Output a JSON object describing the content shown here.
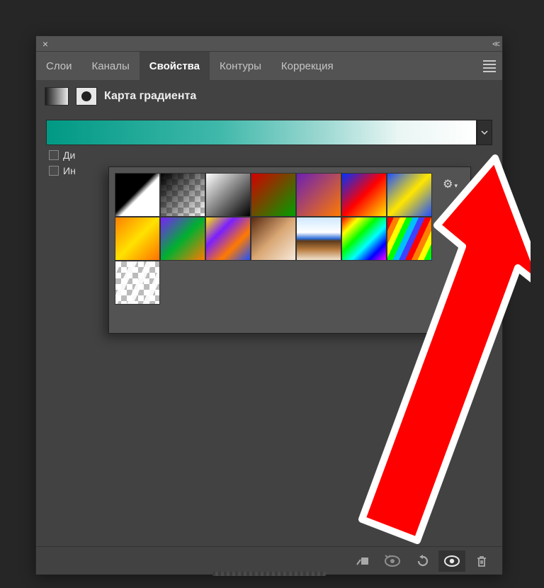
{
  "tabs": {
    "items": [
      "Слои",
      "Каналы",
      "Свойства",
      "Контуры",
      "Коррекция"
    ],
    "activeIndex": 2
  },
  "header": {
    "label": "Карта градиента"
  },
  "checks": {
    "dither": "Ди",
    "invert": "Ин"
  },
  "popup": {
    "gear": "⚙"
  },
  "swatches": [
    {
      "id": "bw",
      "style": "linear-gradient(135deg,#000 0%,#000 45%,#fff 55%,#fff 100%)",
      "cls": ""
    },
    {
      "id": "bw-trans",
      "style": "linear-gradient(135deg,#000 0%,rgba(0,0,0,0) 100%)",
      "cls": "checker"
    },
    {
      "id": "wb",
      "style": "linear-gradient(135deg,#fff 0%,#000 100%)",
      "cls": ""
    },
    {
      "id": "red-green",
      "style": "linear-gradient(135deg,#d30000 0%,#00a000 100%)",
      "cls": ""
    },
    {
      "id": "violet-orange",
      "style": "linear-gradient(135deg,#6b1fb5 0%,#ff7a00 100%)",
      "cls": ""
    },
    {
      "id": "blue-red-yellow",
      "style": "linear-gradient(135deg,#0030ff 0%,#ff0000 50%,#ffe600 100%)",
      "cls": ""
    },
    {
      "id": "blue-yellow-blue",
      "style": "linear-gradient(135deg,#1e50ff 0%,#ffe600 50%,#1e50ff 100%)",
      "cls": ""
    },
    {
      "id": "orange-yellow-orange",
      "style": "linear-gradient(135deg,#ff8000 0%,#ffe200 50%,#ff7000 100%)",
      "cls": ""
    },
    {
      "id": "violet-green-orange",
      "style": "linear-gradient(135deg,#7a1fff 0%,#00b030 50%,#ff7a00 100%)",
      "cls": ""
    },
    {
      "id": "yellow-violet-orange-blue",
      "style": "linear-gradient(135deg,#ffe600 0%,#7a1fff 33%,#ff7a00 66%,#1e50ff 100%)",
      "cls": ""
    },
    {
      "id": "copper",
      "style": "linear-gradient(135deg,#5a2a10 0%,#d9a774 50%,#f7e9da 100%)",
      "cls": ""
    },
    {
      "id": "chrome",
      "style": "linear-gradient(180deg,#cfe8ff 0%,#fff 35%,#2a6bd6 50%,#5c3a1c 55%,#b77a3e 75%,#f2e4cf 100%)",
      "cls": ""
    },
    {
      "id": "spectrum",
      "style": "linear-gradient(135deg,#ff0000 0%,#ffff00 20%,#00ff00 40%,#00ffff 60%,#0000ff 80%,#ff00ff 100%)",
      "cls": ""
    },
    {
      "id": "rainbow-stripes",
      "style": "repeating-linear-gradient(115deg,#ff0000 0 8px,#ff8000 8px 16px,#ffff00 16px 24px,#00ff00 24px 32px,#00bfff 32px 40px,#4040ff 40px 48px)",
      "cls": ""
    },
    {
      "id": "transparent-stripes",
      "style": "repeating-linear-gradient(115deg,rgba(255,255,255,.9) 0 8px, rgba(255,255,255,0) 8px 20px)",
      "cls": "checker"
    }
  ]
}
